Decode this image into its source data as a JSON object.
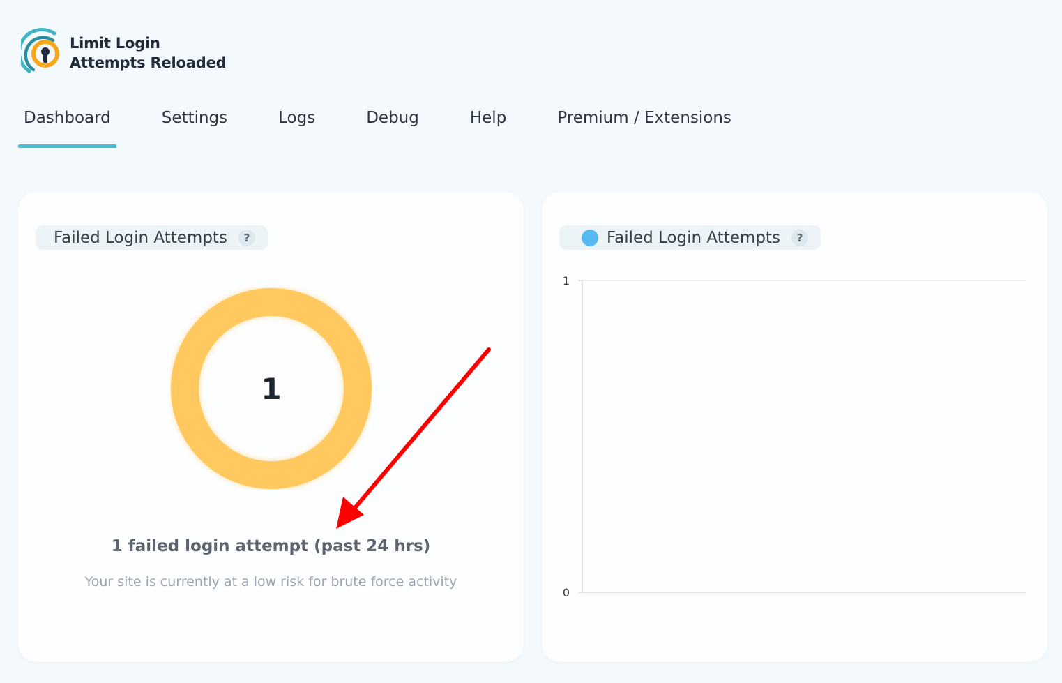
{
  "brand": {
    "name_line1": "Limit Login",
    "name_line2": "Attempts Reloaded"
  },
  "tabs": [
    {
      "label": "Dashboard",
      "active": true
    },
    {
      "label": "Settings",
      "active": false
    },
    {
      "label": "Logs",
      "active": false
    },
    {
      "label": "Debug",
      "active": false
    },
    {
      "label": "Help",
      "active": false
    },
    {
      "label": "Premium / Extensions",
      "active": false
    }
  ],
  "left_card": {
    "title": "Failed Login Attempts",
    "help_glyph": "?",
    "donut_value": "1",
    "donut_color": "#ffc95f",
    "summary": "1 failed login attempt (past 24 hrs)",
    "risk_text": "Your site is currently at a low risk for brute force activity"
  },
  "right_card": {
    "legend_label": "Failed Login Attempts",
    "help_glyph": "?",
    "series_color": "#56b9f2"
  },
  "annotation": {
    "arrow_color": "#ff0000"
  },
  "chart_data": {
    "type": "line",
    "yticks": [
      "1",
      "0"
    ],
    "ylim": [
      0,
      1
    ],
    "series": [
      {
        "name": "Failed Login Attempts",
        "values": []
      }
    ]
  }
}
